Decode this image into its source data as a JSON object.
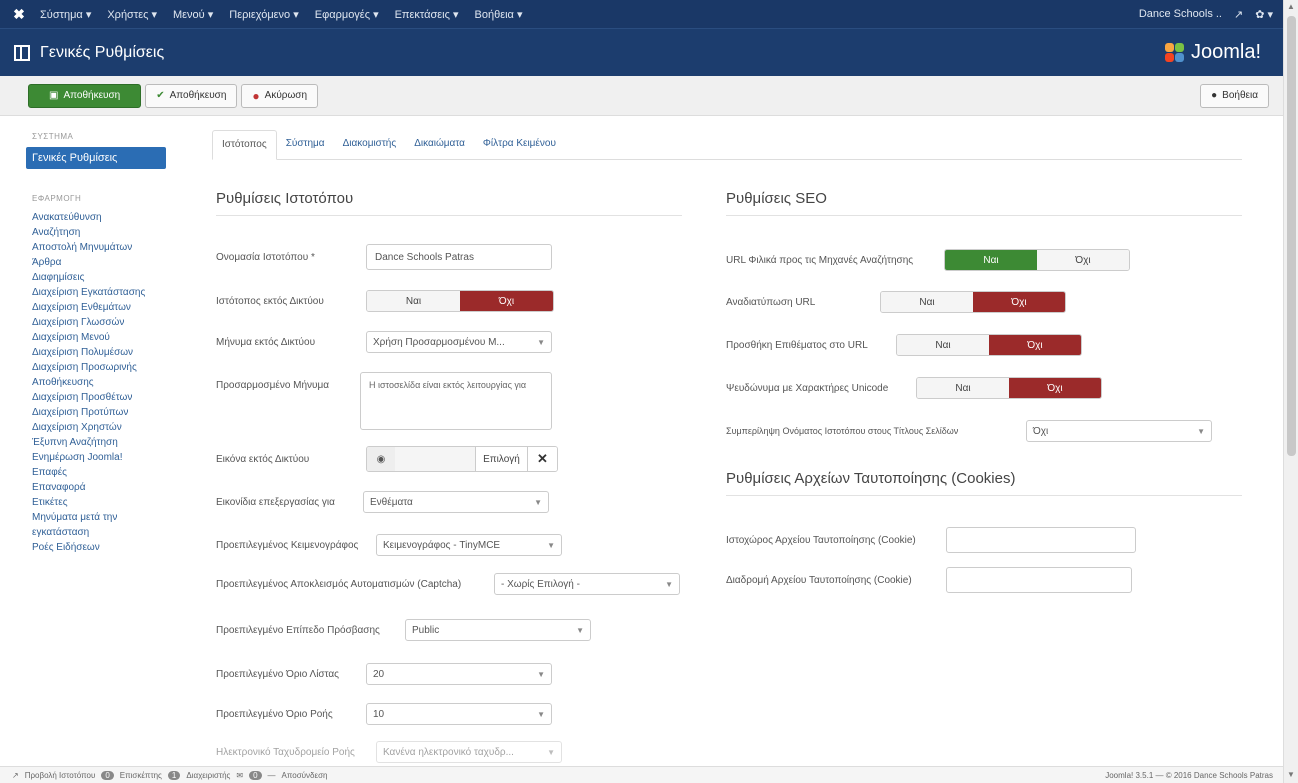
{
  "topnav": {
    "menu": [
      "Σύστημα ▾",
      "Χρήστες ▾",
      "Μενού ▾",
      "Περιεχόμενο ▾",
      "Εφαρμογές ▾",
      "Επεκτάσεις ▾",
      "Βοήθεια ▾"
    ],
    "site_name": "Dance Schools ..",
    "external_icon": "↗",
    "user_icon": "✿ ▾"
  },
  "header": {
    "title": "Γενικές Ρυθμίσεις",
    "brand": "Joomla!"
  },
  "toolbar": {
    "save": "Αποθήκευση",
    "save_close": "Αποθήκευση",
    "cancel": "Ακύρωση",
    "help": "Βοήθεια"
  },
  "sidebar": {
    "system_head": "ΣΥΣΤΗΜΑ",
    "active": "Γενικές Ρυθμίσεις",
    "components_head": "ΕΦΑΡΜΟΓΗ",
    "items": [
      "Ανακατεύθυνση",
      "Αναζήτηση",
      "Αποστολή Μηνυμάτων",
      "Άρθρα",
      "Διαφημίσεις",
      "Διαχείριση Εγκατάστασης",
      "Διαχείριση Ενθεμάτων",
      "Διαχείριση Γλωσσών",
      "Διαχείριση Μενού",
      "Διαχείριση Πολυμέσων",
      "Διαχείριση Προσωρινής\nΑποθήκευσης",
      "Διαχείριση Προσθέτων",
      "Διαχείριση Προτύπων",
      "Διαχείριση Χρηστών",
      "Έξυπνη Αναζήτηση",
      "Ενημέρωση Joomla!",
      "Επαφές",
      "Επαναφορά",
      "Ετικέτες",
      "Μηνύματα μετά την\nεγκατάσταση",
      "Ροές Ειδήσεων"
    ]
  },
  "tabs": [
    "Ιστότοπος",
    "Σύστημα",
    "Διακομιστής",
    "Δικαιώματα",
    "Φίλτρα Κειμένου"
  ],
  "site": {
    "heading": "Ρυθμίσεις Ιστοτόπου",
    "name_label": "Ονομασία Ιστοτόπου *",
    "name_value": "Dance Schools Patras",
    "offline_label": "Ιστότοπος εκτός Δικτύου",
    "offline_message_label": "Μήνυμα εκτός Δικτύου",
    "offline_message_value": "Χρήση Προσαρμοσμένου Μ...",
    "custom_message_label": "Προσαρμοσμένο Μήνυμα",
    "custom_message_value": "Η ιστοσελίδα είναι εκτός λειτουργίας για",
    "offline_image_label": "Εικόνα εκτός Δικτύου",
    "offline_image_select": "Επιλογή",
    "edit_icons_label": "Εικονίδια επεξεργασίας για",
    "edit_icons_value": "Ενθέματα",
    "editor_label": "Προεπιλεγμένος Κειμενογράφος",
    "editor_value": "Κειμενογράφος - TinyMCE",
    "captcha_label": "Προεπιλεγμένος Αποκλεισμός Αυτοματισμών (Captcha)",
    "captcha_value": "- Χωρίς Επιλογή -",
    "access_label": "Προεπιλεγμένο Επίπεδο Πρόσβασης",
    "access_value": "Public",
    "list_limit_label": "Προεπιλεγμένο Όριο Λίστας",
    "list_limit_value": "20",
    "feed_limit_label": "Προεπιλεγμένο Όριο Ροής",
    "feed_limit_value": "10",
    "feed_email_label": "Ηλεκτρονικό Ταχυδρομείο Ροής",
    "feed_email_value": "Κανένα ηλεκτρονικό ταχυδρ..."
  },
  "toggle": {
    "yes": "Ναι",
    "no": "Όχι"
  },
  "seo": {
    "heading": "Ρυθμίσεις SEO",
    "sef_label": "URL Φιλικά προς τις Μηχανές Αναζήτησης",
    "rewrite_label": "Αναδιατύπωση URL",
    "suffix_label": "Προσθήκη Επιθέματος στο URL",
    "unicode_label": "Ψευδώνυμα με Χαρακτήρες Unicode",
    "sitename_label": "Συμπερίληψη Ονόματος Ιστοτόπου στους Τίτλους Σελίδων",
    "sitename_value": "Όχι"
  },
  "cookies": {
    "heading": "Ρυθμίσεις Αρχείων Ταυτοποίησης (Cookies)",
    "domain_label": "Ιστοχώρος Αρχείου Ταυτοποίησης (Cookie)",
    "domain_value": "",
    "path_label": "Διαδρομή Αρχείου Ταυτοποίησης (Cookie)",
    "path_value": ""
  },
  "statusbar": {
    "view_site": "Προβολή Ιστοτόπου",
    "visitors_count": "0",
    "visitors": "Επισκέπτης",
    "admins_count": "1",
    "admins": "Διαχειριστής",
    "messages_count": "0",
    "logout": "Αποσύνδεση",
    "version": "Joomla! 3.5.1 — © 2016 Dance Schools Patras"
  }
}
